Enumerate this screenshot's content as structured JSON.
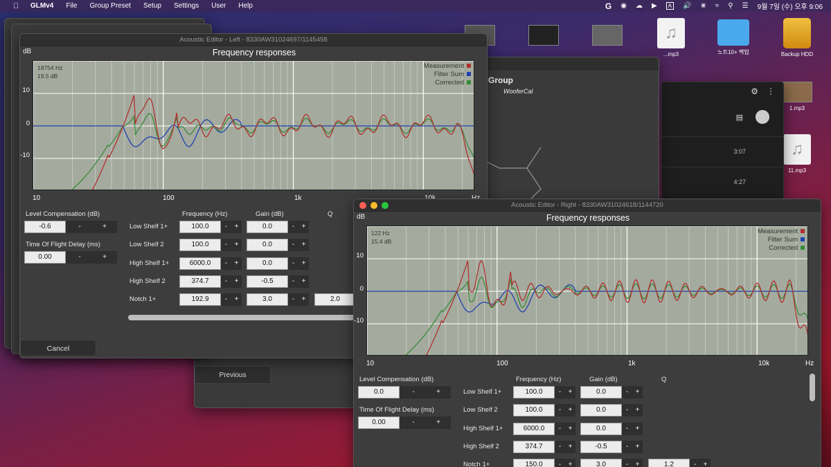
{
  "menubar": {
    "app": "GLMv4",
    "items": [
      "File",
      "Group Preset",
      "Setup",
      "Settings",
      "User",
      "Help"
    ],
    "clock": "9월 7일 (수) 오후 9:06",
    "input_method": "A"
  },
  "desktop": {
    "icons": [
      {
        "label": "",
        "kind": "thumb"
      },
      {
        "label": "",
        "kind": "thumb"
      },
      {
        "label": "",
        "kind": "thumb"
      },
      {
        "label": "...mp3",
        "kind": "doc"
      },
      {
        "label": "노트10+ 백업",
        "kind": "folder"
      },
      {
        "label": "Backup HDD",
        "kind": "hdd"
      },
      {
        "label": "1.mp3",
        "kind": "thumb"
      },
      {
        "label": "11.mp3",
        "kind": "doc"
      }
    ]
  },
  "group_window": {
    "title": "Group",
    "sub1": "e",
    "sub2": "WooferCal",
    "previous_label": "Previous"
  },
  "media_window": {
    "rows": [
      "3:07",
      "4:27"
    ]
  },
  "left_editor": {
    "title": "Acoustic Editor - Left - 8330AW31024697/1145458",
    "db_label": "dB",
    "chart_title": "Frequency responses",
    "readout_freq": "18754 Hz",
    "readout_db": "19.5 dB",
    "legend": [
      {
        "name": "Measurement",
        "color": "#b03030"
      },
      {
        "name": "Filter Sum",
        "color": "#2040b0"
      },
      {
        "name": "Corrected",
        "color": "#3a8a3a"
      }
    ],
    "y_ticks": [
      "10",
      "0",
      "-10"
    ],
    "x_ticks": [
      "10",
      "100",
      "1k",
      "10k",
      "Hz"
    ],
    "level_comp_label": "Level Compensation (dB)",
    "level_comp_value": "-0.6",
    "tof_label": "Time Of Flight Delay (ms)",
    "tof_value": "0.00",
    "col_freq": "Frequency (Hz)",
    "col_gain": "Gain (dB)",
    "col_q": "Q",
    "filters": [
      {
        "name": "Low Shelf 1+",
        "freq": "100.0",
        "gain": "0.0",
        "q": ""
      },
      {
        "name": "Low Shelf 2",
        "freq": "100.0",
        "gain": "0.0",
        "q": ""
      },
      {
        "name": "High Shelf 1+",
        "freq": "6000.0",
        "gain": "0.0",
        "q": ""
      },
      {
        "name": "High Shelf 2",
        "freq": "374.7",
        "gain": "-0.5",
        "q": ""
      },
      {
        "name": "Notch 1+",
        "freq": "192.9",
        "gain": "3.0",
        "q": "2.0"
      }
    ],
    "minus": "-",
    "plus": "+",
    "cancel_label": "Cancel"
  },
  "right_editor": {
    "title": "Acoustic Editor - Right - 8330AW31024618/1144720",
    "db_label": "dB",
    "chart_title": "Frequency responses",
    "readout_freq": "122 Hz",
    "readout_db": "15.4 dB",
    "legend": [
      {
        "name": "Measurement",
        "color": "#b03030"
      },
      {
        "name": "Filter Sum",
        "color": "#2040b0"
      },
      {
        "name": "Corrected",
        "color": "#3a8a3a"
      }
    ],
    "y_ticks": [
      "10",
      "0",
      "-10"
    ],
    "x_ticks": [
      "10",
      "100",
      "1k",
      "10k",
      "Hz"
    ],
    "level_comp_label": "Level Compensation (dB)",
    "level_comp_value": "0.0",
    "tof_label": "Time Of Flight Delay (ms)",
    "tof_value": "0.00",
    "col_freq": "Frequency (Hz)",
    "col_gain": "Gain (dB)",
    "col_q": "Q",
    "filters": [
      {
        "name": "Low Shelf 1+",
        "freq": "100.0",
        "gain": "0.0",
        "q": ""
      },
      {
        "name": "Low Shelf 2",
        "freq": "100.0",
        "gain": "0.0",
        "q": ""
      },
      {
        "name": "High Shelf 1+",
        "freq": "6000.0",
        "gain": "0.0",
        "q": ""
      },
      {
        "name": "High Shelf 2",
        "freq": "374.7",
        "gain": "-0.5",
        "q": ""
      },
      {
        "name": "Notch 1+",
        "freq": "150.0",
        "gain": "3.0",
        "q": "1.2"
      }
    ],
    "minus": "-",
    "plus": "+"
  }
}
